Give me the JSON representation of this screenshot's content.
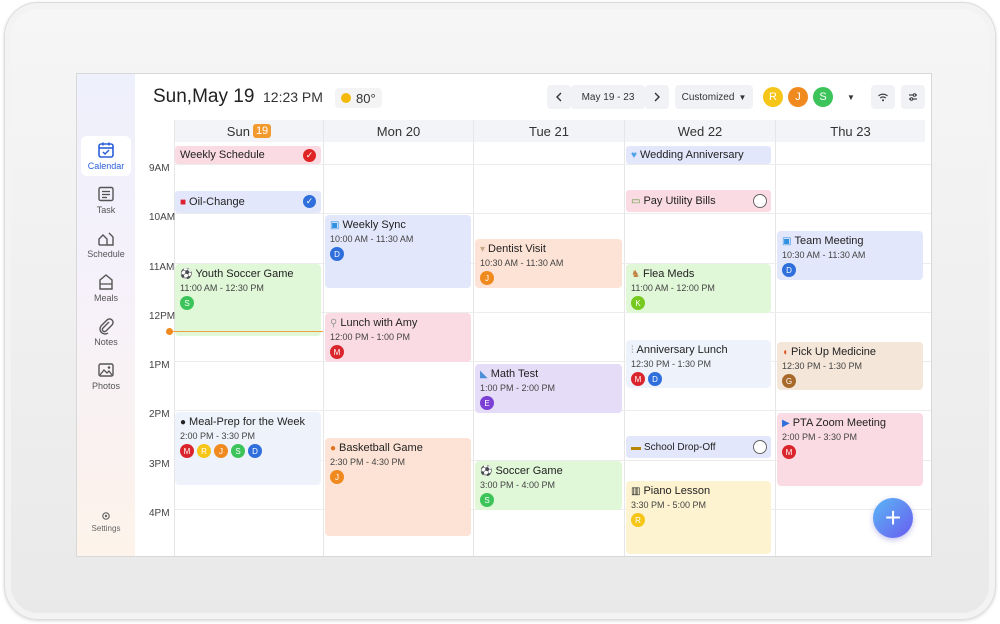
{
  "header": {
    "date": "Sun,May 19",
    "time": "12:23 PM",
    "weather_temp": "80°",
    "date_range": "May 19 - 23",
    "view_mode": "Customized",
    "family": [
      "R",
      "J",
      "S"
    ]
  },
  "sidebar": {
    "items": [
      {
        "label": "Calendar",
        "icon": "calendar-icon"
      },
      {
        "label": "Task",
        "icon": "task-list-icon"
      },
      {
        "label": "Schedule",
        "icon": "schedule-icon"
      },
      {
        "label": "Meals",
        "icon": "meals-icon"
      },
      {
        "label": "Notes",
        "icon": "paperclip-icon"
      },
      {
        "label": "Photos",
        "icon": "photos-icon"
      }
    ],
    "settings_label": "Settings"
  },
  "days": [
    {
      "name": "Sun",
      "num": "19",
      "today": true
    },
    {
      "name": "Mon",
      "num": "20"
    },
    {
      "name": "Tue",
      "num": "21"
    },
    {
      "name": "Wed",
      "num": "22"
    },
    {
      "name": "Thu",
      "num": "23"
    }
  ],
  "hours": [
    "9AM",
    "10AM",
    "11AM",
    "12PM",
    "1PM",
    "2PM",
    "3PM",
    "4PM"
  ],
  "allday": {
    "weekly_schedule": "Weekly Schedule",
    "wedding_anniversary": "Wedding Anniversary",
    "oil_change": "Oil-Change",
    "pay_utility_bills": "Pay Utility Bills",
    "school_drop_off": "School Drop-Off"
  },
  "events": {
    "youth_soccer": {
      "title": "Youth Soccer Game",
      "time": "11:00 AM - 12:30 PM",
      "people": [
        "S"
      ]
    },
    "meal_prep": {
      "title": "Meal-Prep for the Week",
      "time": "2:00 PM - 3:30 PM",
      "people": [
        "M",
        "R",
        "J",
        "S",
        "D"
      ]
    },
    "weekly_sync": {
      "title": "Weekly Sync",
      "time": "10:00 AM - 11:30 AM",
      "people": [
        "D"
      ]
    },
    "lunch_amy": {
      "title": "Lunch with Amy",
      "time": "12:00 PM - 1:00 PM",
      "people": [
        "M"
      ]
    },
    "basketball": {
      "title": "Basketball Game",
      "time": "2:30 PM - 4:30 PM",
      "people": [
        "J"
      ]
    },
    "dentist": {
      "title": "Dentist Visit",
      "time": "10:30 AM - 11:30 AM",
      "people": [
        "J"
      ]
    },
    "math_test": {
      "title": "Math Test",
      "time": "1:00 PM - 2:00 PM",
      "people": [
        "E"
      ]
    },
    "soccer_game": {
      "title": "Soccer Game",
      "time": "3:00 PM - 4:00 PM",
      "people": [
        "S"
      ]
    },
    "flea_meds": {
      "title": "Flea Meds",
      "time": "11:00 AM - 12:00 PM",
      "people": [
        "K"
      ]
    },
    "anniversary_lunch": {
      "title": "Anniversary Lunch",
      "time": "12:30 PM - 1:30 PM",
      "people": [
        "M",
        "D"
      ]
    },
    "piano": {
      "title": "Piano Lesson",
      "time": "3:30 PM - 5:00 PM",
      "people": [
        "R"
      ]
    },
    "team_meeting": {
      "title": "Team Meeting",
      "time": "10:30 AM - 11:30 AM",
      "people": [
        "D"
      ]
    },
    "pick_up_medicine": {
      "title": "Pick Up Medicine",
      "time": "12:30 PM - 1:30 PM",
      "people": [
        "G"
      ]
    },
    "pta_zoom": {
      "title": "PTA Zoom Meeting",
      "time": "2:00 PM - 3:30 PM",
      "people": [
        "M"
      ]
    }
  },
  "colors": {
    "accent": "#2b5fd9",
    "today": "#f29a2e",
    "person_M": "#d9252b",
    "person_R": "#f5c518",
    "person_J": "#f08a1e",
    "person_S": "#3cc45a",
    "person_D": "#2f6fdc",
    "person_E": "#7b3fd6",
    "person_K": "#76c91e",
    "person_G": "#a86a2a"
  }
}
